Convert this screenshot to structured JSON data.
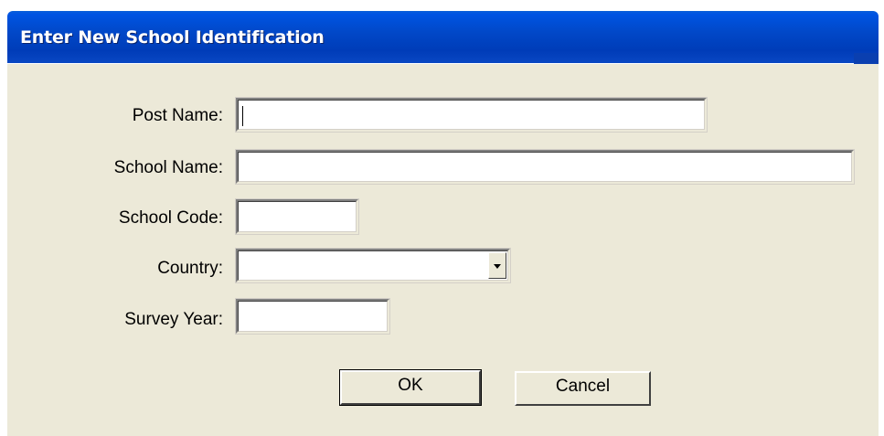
{
  "window": {
    "title": "Enter New School Identification"
  },
  "form": {
    "post_name": {
      "label": "Post Name:",
      "value": ""
    },
    "school_name": {
      "label": "School Name:",
      "value": ""
    },
    "school_code": {
      "label": "School Code:",
      "value": ""
    },
    "country": {
      "label": "Country:",
      "selected": ""
    },
    "survey_year": {
      "label": "Survey Year:",
      "value": ""
    }
  },
  "buttons": {
    "ok_label": "OK",
    "cancel_label": "Cancel"
  },
  "colors": {
    "titlebar": "#0054e3",
    "client_background": "#ece9d8",
    "title_text": "#ffffff"
  },
  "icons": {
    "dropdown": "chevron-down-icon"
  }
}
